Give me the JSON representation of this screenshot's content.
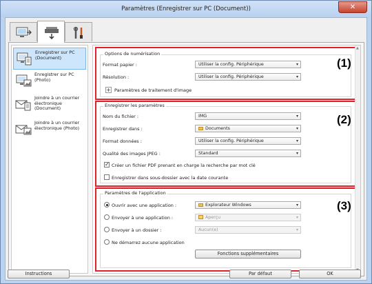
{
  "window": {
    "title": "Paramètres (Enregistrer sur PC (Document))",
    "close_glyph": "✕"
  },
  "tabs": [
    {
      "name": "scan-from-computer",
      "icon": "monitor-scan-icon"
    },
    {
      "name": "scan-from-operation-panel",
      "icon": "scanner-icon"
    },
    {
      "name": "general-settings",
      "icon": "tools-icon"
    }
  ],
  "sidebar": {
    "items": [
      {
        "label": "Enregistrer sur PC (Document)",
        "selected": true
      },
      {
        "label": "Enregistrer sur PC (Photo)"
      },
      {
        "label": "Joindre à un courrier électronique (Document)"
      },
      {
        "label": "Joindre à un courrier électronique (Photo)"
      }
    ]
  },
  "scan_options": {
    "group_title": "Options de numérisation",
    "paper_format_label": "Format papier :",
    "paper_format_value": "Utiliser la config. Périphérique",
    "resolution_label": "Résolution :",
    "resolution_value": "Utiliser la config. Périphérique",
    "image_processing_label": "Paramètres de traitement d'image",
    "badge": "(1)"
  },
  "save_settings": {
    "group_title": "Enregistrer les paramètres",
    "file_name_label": "Nom du fichier :",
    "file_name_value": "IMG",
    "save_in_label": "Enregistrer dans :",
    "save_in_value": "Documents",
    "data_format_label": "Format données :",
    "data_format_value": "Utiliser la config. Périphérique",
    "jpeg_quality_label": "Qualité des images JPEG :",
    "jpeg_quality_value": "Standard",
    "pdf_keyword_label": "Créer un fichier PDF prenant en charge la recherche par mot clé",
    "pdf_keyword_checked": true,
    "subfolder_label": "Enregistrer dans sous-dossier avec la date courante",
    "subfolder_checked": false,
    "badge": "(2)"
  },
  "app_settings": {
    "group_title": "Paramètres de l'application",
    "open_with_label": "Ouvrir avec une application :",
    "open_with_value": "Explorateur Windows",
    "send_to_app_label": "Envoyer à une application :",
    "send_to_app_value": "Aperçu",
    "send_to_folder_label": "Envoyer à un dossier :",
    "send_to_folder_value": "Aucun(e)",
    "no_app_label": "Ne démarrez aucune application",
    "selected_option": "open_with",
    "more_functions_label": "Fonctions supplémentaires",
    "badge": "(3)"
  },
  "footer": {
    "instructions_label": "Instructions",
    "defaults_label": "Par défaut",
    "ok_label": "OK"
  }
}
